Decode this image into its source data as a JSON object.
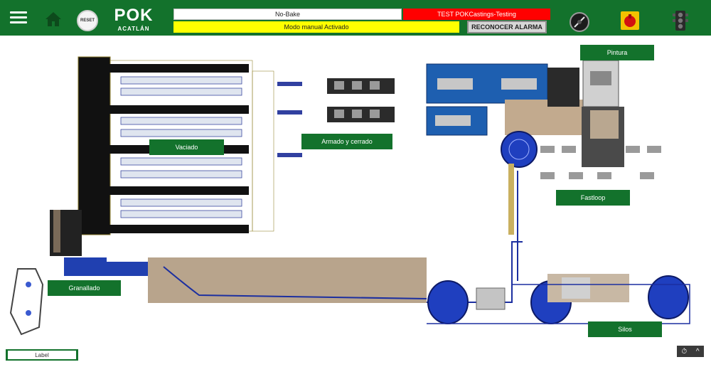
{
  "header": {
    "logo_brand": "POK",
    "logo_location": "ACATLÁN",
    "reset_label": "RESET",
    "process_field": "No-Bake",
    "test_field": "TEST POKCastings-Testing",
    "mode_field": "Modo manual Activado",
    "ack_button": "RECONOCER ALARMA",
    "colors": {
      "bar": "#13722c",
      "alarm": "#ff0000",
      "mode": "#ffff00"
    }
  },
  "zones": {
    "vaciado": "Vaciado",
    "armado": "Armado y cerrado",
    "pintura": "Pintura",
    "fastloop": "Fastloop",
    "granallado": "Granallado",
    "silos": "Silos"
  },
  "footer": {
    "label": "Label"
  },
  "icons": [
    "menu-icon",
    "home-icon",
    "reset-button",
    "gauge-icon",
    "emergency-stop-icon",
    "traffic-light-icon"
  ]
}
